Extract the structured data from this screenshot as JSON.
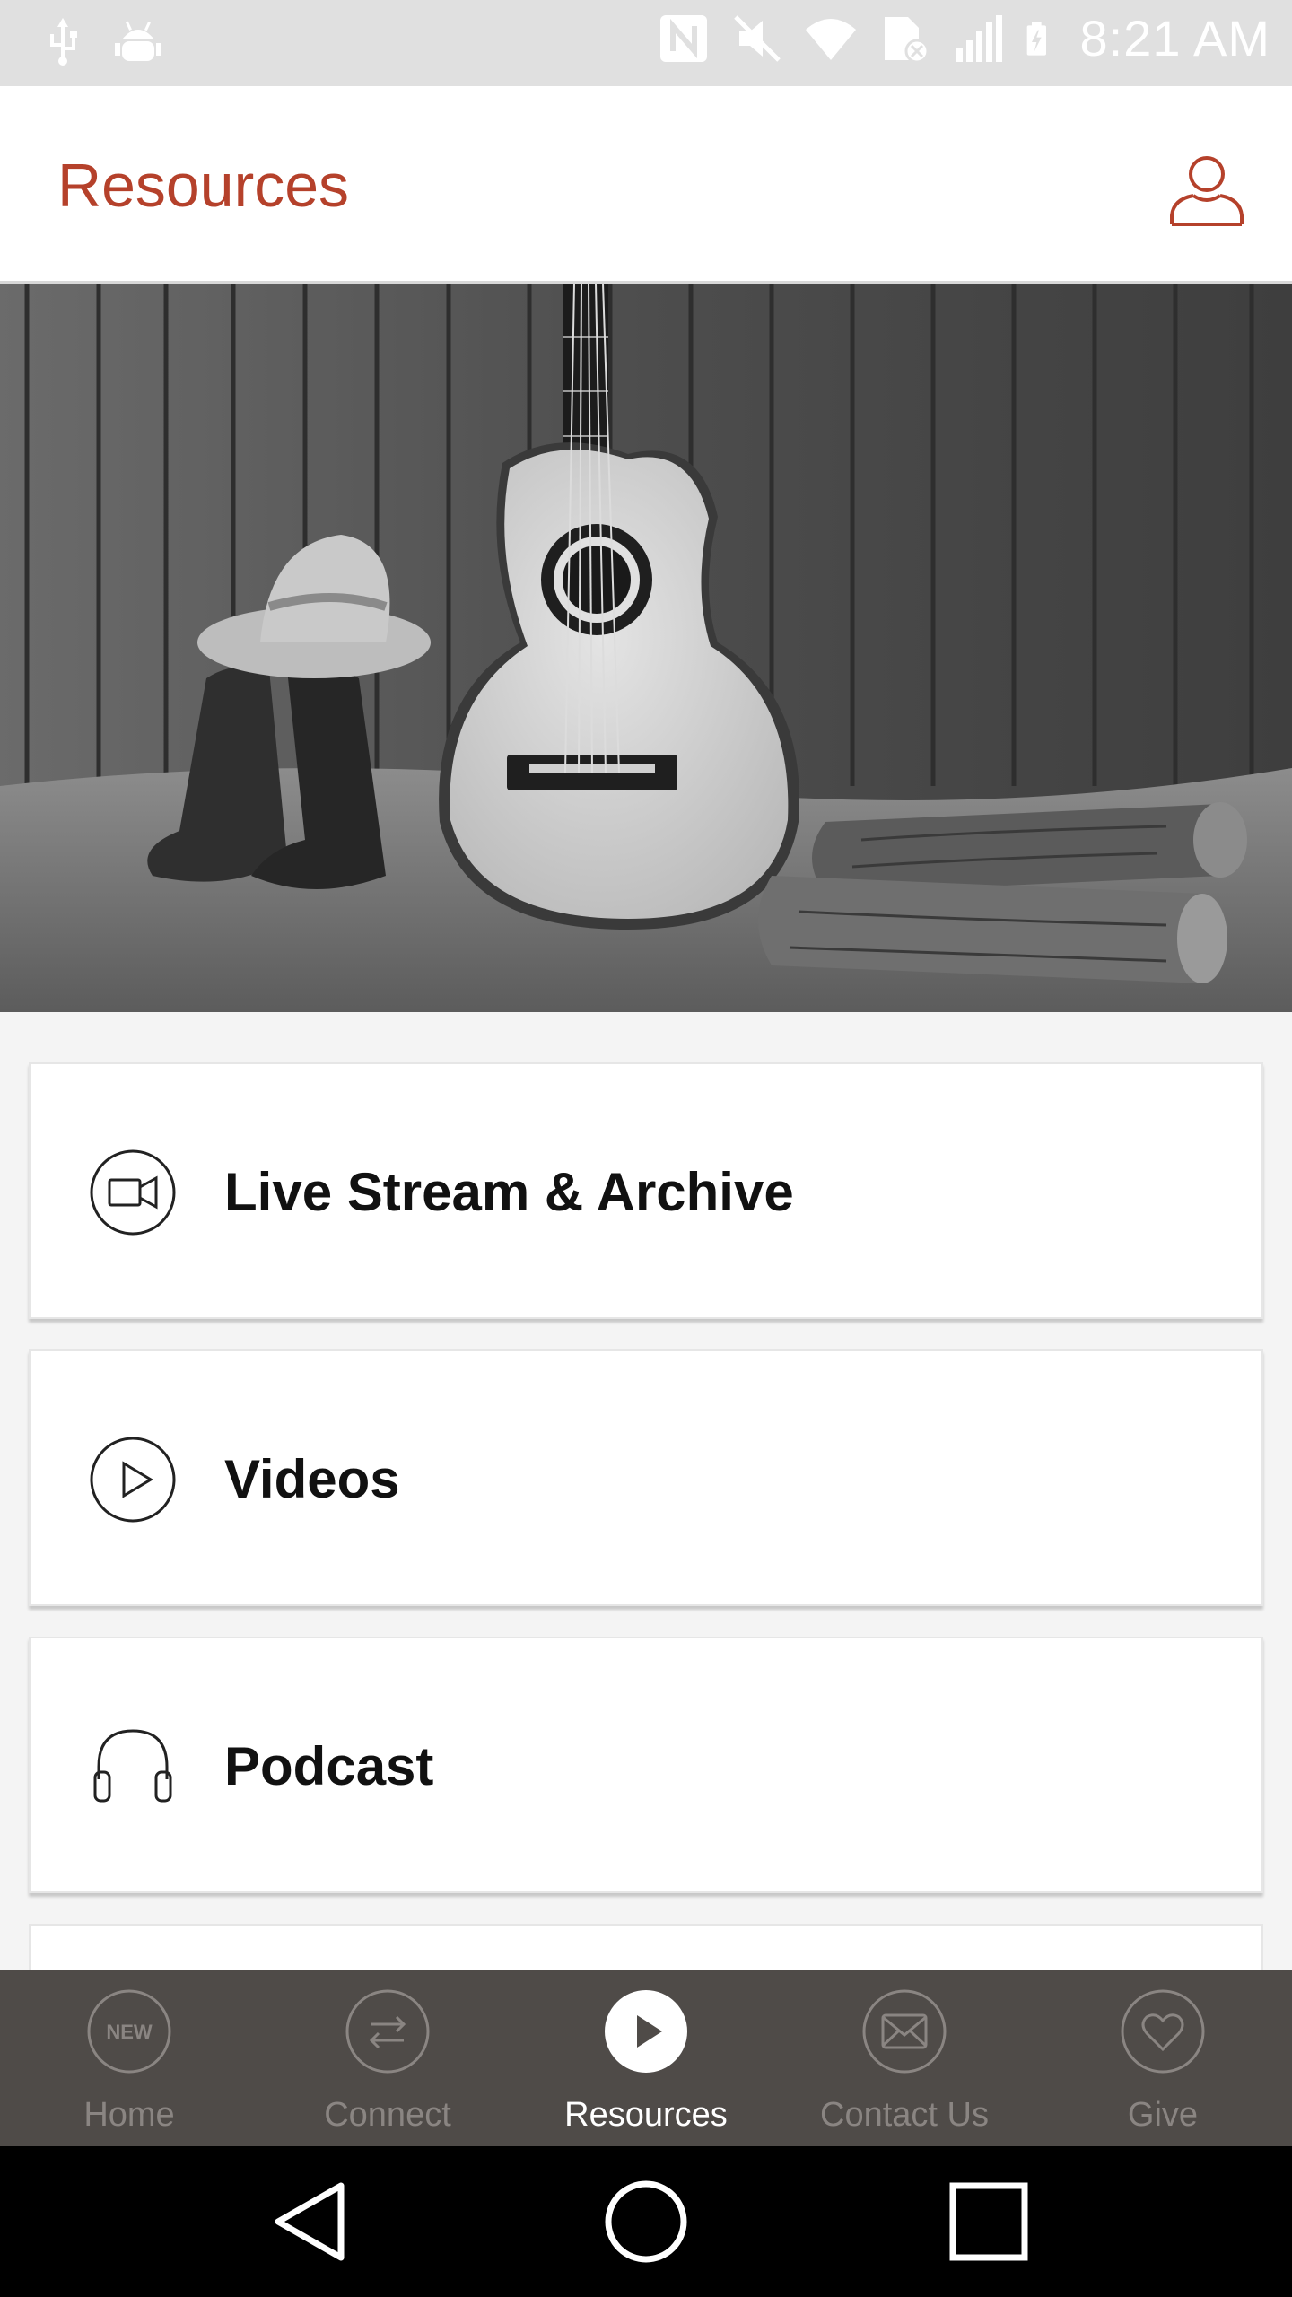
{
  "status_bar": {
    "time": "8:21 AM",
    "icons": [
      "usb-icon",
      "android-debug-icon",
      "nfc-icon",
      "mute-icon",
      "wifi-icon",
      "sim-alert-icon",
      "signal-icon",
      "battery-charging-icon"
    ]
  },
  "header": {
    "title": "Resources",
    "profile_icon": "profile-icon"
  },
  "hero": {
    "description_icon": "hero-image"
  },
  "menu": {
    "items": [
      {
        "label": "Live Stream & Archive",
        "icon": "video-camera-icon"
      },
      {
        "label": "Videos",
        "icon": "play-circle-icon"
      },
      {
        "label": "Podcast",
        "icon": "headphones-icon"
      }
    ]
  },
  "bottom_nav": {
    "active_index": 2,
    "items": [
      {
        "label": "Home",
        "icon": "new-badge-icon"
      },
      {
        "label": "Connect",
        "icon": "swap-arrows-icon"
      },
      {
        "label": "Resources",
        "icon": "play-icon"
      },
      {
        "label": "Contact Us",
        "icon": "mail-icon"
      },
      {
        "label": "Give",
        "icon": "heart-icon"
      }
    ],
    "home_badge_text": "NEW"
  },
  "colors": {
    "accent": "#b5412b",
    "nav_background": "#4f4b48",
    "status_bar": "#e0e0e0"
  }
}
